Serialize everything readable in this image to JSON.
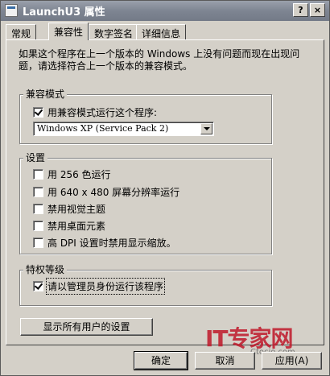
{
  "window": {
    "title": "LaunchU3 属性",
    "help_label": "?",
    "close_label": "×"
  },
  "tabs": [
    {
      "label": "常规",
      "active": false
    },
    {
      "label": "兼容性",
      "active": true
    },
    {
      "label": "数字签名",
      "active": false
    },
    {
      "label": "详细信息",
      "active": false
    }
  ],
  "description": "如果这个程序在上一个版本的 Windows 上没有问题而现在出现问题，请选择符合上一个版本的兼容模式。",
  "compat_mode": {
    "legend": "兼容模式",
    "checkbox_label": "用兼容模式运行这个程序:",
    "checked": true,
    "selected_os": "Windows XP (Service Pack 2)"
  },
  "settings": {
    "legend": "设置",
    "items": [
      {
        "label": "用 256 色运行",
        "checked": false
      },
      {
        "label": "用 640 x 480 屏幕分辨率运行",
        "checked": false
      },
      {
        "label": "禁用视觉主题",
        "checked": false
      },
      {
        "label": "禁用桌面元素",
        "checked": false
      },
      {
        "label": "高 DPI 设置时禁用显示缩放。",
        "checked": false
      }
    ]
  },
  "privilege": {
    "legend": "特权等级",
    "checkbox_label": "请以管理员身份运行该程序",
    "checked": true
  },
  "show_all_users_label": "显示所有用户的设置",
  "buttons": {
    "ok": "确定",
    "cancel": "取消",
    "apply": "应用(A)"
  },
  "watermark": {
    "brand": "IT专家网",
    "sub": "Ctocio.com"
  }
}
